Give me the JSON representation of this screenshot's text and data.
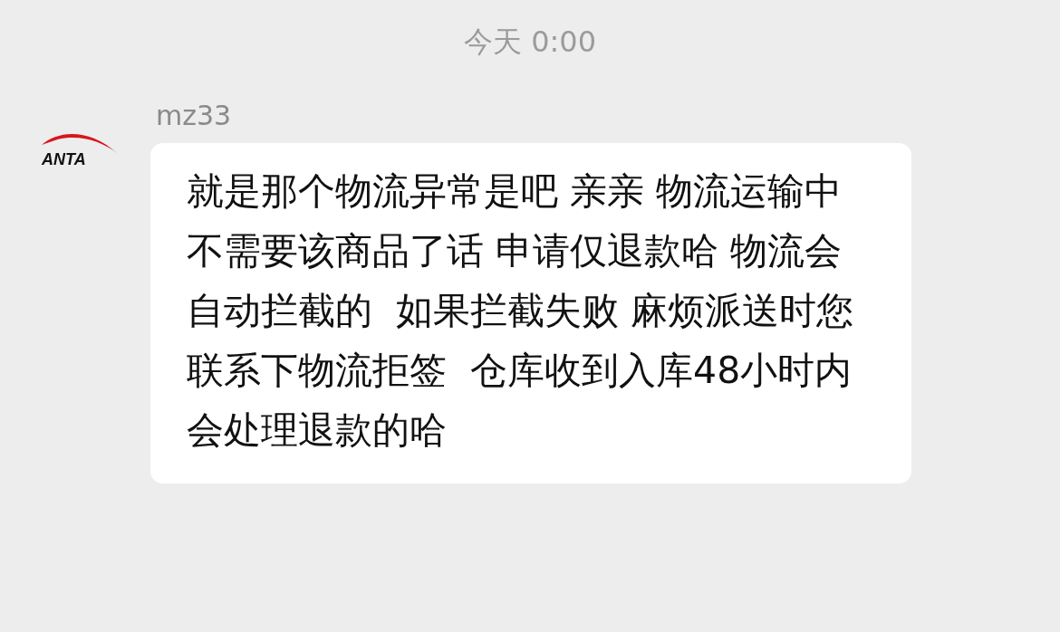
{
  "timestamp": "今天 0:00",
  "messages": [
    {
      "sender": "mz33",
      "avatar_text": "ANTA",
      "text": "就是那个物流异常是吧 亲亲 物流运输中不需要该商品了话 申请仅退款哈 物流会自动拦截的  如果拦截失败 麻烦派送时您联系下物流拒签  仓库收到入库48小时内会处理退款的哈"
    }
  ]
}
